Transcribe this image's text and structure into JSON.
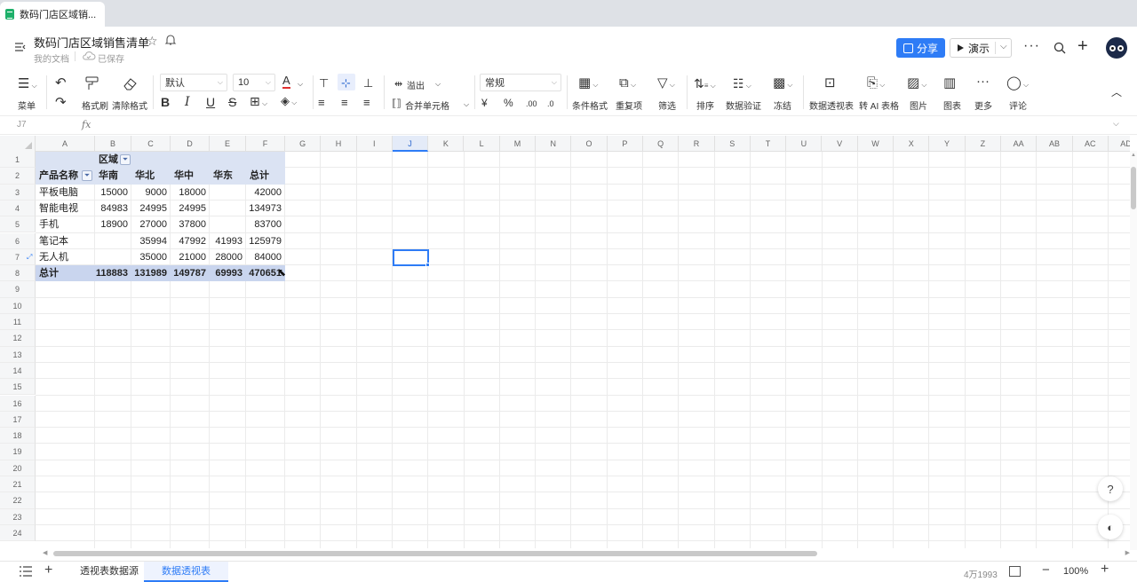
{
  "browser": {
    "tab_title": "数码门店区域销..."
  },
  "doc": {
    "title": "数码门店区域销售清单",
    "location": "我的文档",
    "save_status": "已保存"
  },
  "header": {
    "share_label": "分享",
    "present_label": "演示",
    "more": "···",
    "plus": "+"
  },
  "toolbar": {
    "menu": "菜单",
    "format_painter": "格式刷",
    "clear_format": "清除格式",
    "font_name": "默认",
    "font_size": "10",
    "overflow": "溢出",
    "merge": "合并单元格",
    "number_format": "常规",
    "currency": "¥",
    "percent": "%",
    "cond_format": "条件格式",
    "duplicates": "重复项",
    "filter": "筛选",
    "sort": "排序",
    "validation": "数据验证",
    "freeze": "冻结",
    "pivot": "数据透视表",
    "ai_table": "转 AI 表格",
    "image": "图片",
    "chart": "图表",
    "more": "更多",
    "comment": "评论"
  },
  "formula_bar": {
    "cell_ref": "J7",
    "fx": "fx",
    "value": ""
  },
  "grid": {
    "columns": [
      "A",
      "B",
      "C",
      "D",
      "E",
      "F",
      "G",
      "H",
      "I",
      "J",
      "K",
      "L",
      "M",
      "N",
      "O",
      "P",
      "Q",
      "R",
      "S",
      "T",
      "U",
      "V",
      "W",
      "X",
      "Y",
      "Z",
      "AA",
      "AB",
      "AC",
      "AD"
    ],
    "rows": [
      "1",
      "2",
      "3",
      "4",
      "5",
      "6",
      "7",
      "8",
      "9",
      "10",
      "11",
      "12",
      "13",
      "14",
      "15",
      "16",
      "17",
      "18",
      "19",
      "20",
      "21",
      "22",
      "23",
      "24"
    ],
    "selected_cell": "J7"
  },
  "pivot": {
    "region_header": "区域",
    "row_header": "产品名称",
    "columns": [
      "华南",
      "华北",
      "华中",
      "华东",
      "总计"
    ],
    "rows": [
      {
        "name": "平板电脑",
        "values": [
          "15000",
          "9000",
          "18000",
          "",
          "42000"
        ]
      },
      {
        "name": "智能电视",
        "values": [
          "84983",
          "24995",
          "24995",
          "",
          "134973"
        ]
      },
      {
        "name": "手机",
        "values": [
          "18900",
          "27000",
          "37800",
          "",
          "83700"
        ]
      },
      {
        "name": "笔记本",
        "values": [
          "",
          "35994",
          "47992",
          "41993",
          "125979"
        ]
      },
      {
        "name": "无人机",
        "values": [
          "",
          "35000",
          "21000",
          "28000",
          "84000"
        ]
      }
    ],
    "total": {
      "name": "总计",
      "values": [
        "118883",
        "131989",
        "149787",
        "69993",
        "470651"
      ]
    }
  },
  "sheets": [
    "透视表数据源",
    "数据透视表"
  ],
  "active_sheet": 1,
  "status": {
    "stat": "4万1993",
    "zoom": "100%"
  },
  "colors": {
    "accent": "#2e7cf6",
    "pivot_header": "#dbe3f3",
    "pivot_total": "#c9d5ee"
  }
}
